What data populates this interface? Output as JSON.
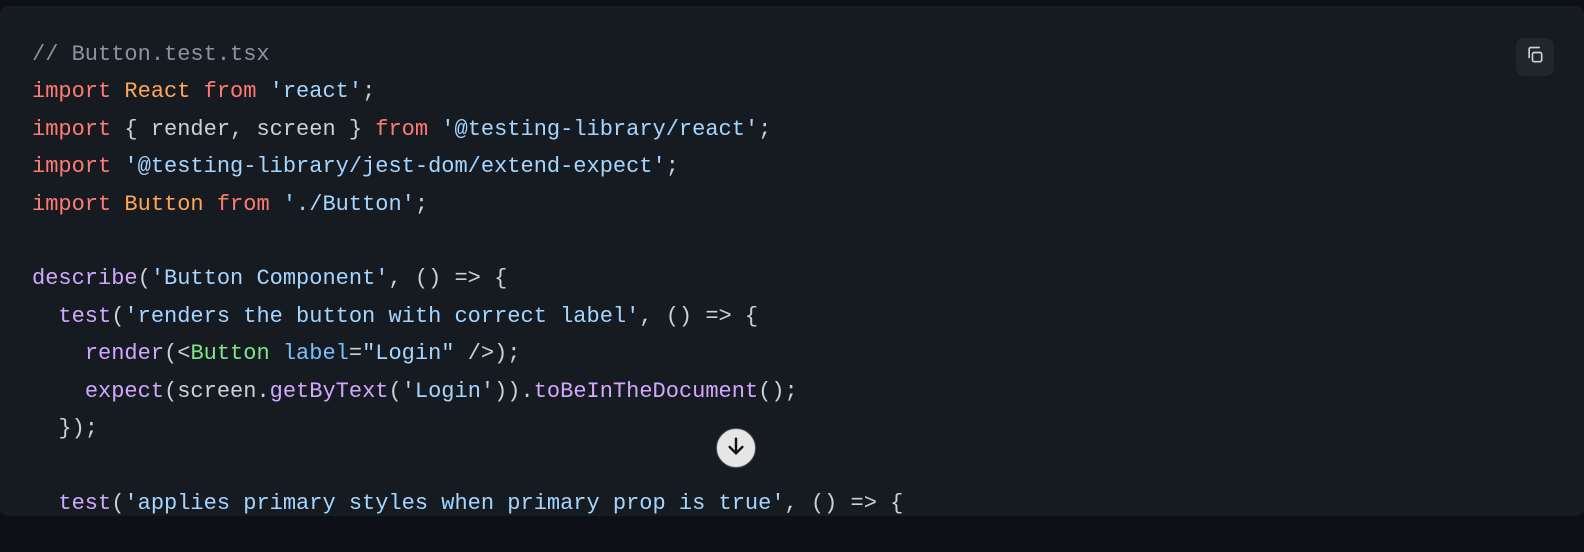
{
  "code": {
    "line1": {
      "comment": "// Button.test.tsx"
    },
    "line2": {
      "kw_import": "import",
      "name": "React",
      "kw_from": "from",
      "str": "'react'",
      "semi": ";"
    },
    "line3": {
      "kw_import": "import",
      "lbrace": " { ",
      "names": "render, screen",
      "rbrace": " } ",
      "kw_from": "from",
      "str": "'@testing-library/react'",
      "semi": ";"
    },
    "line4": {
      "kw_import": "import",
      "str": "'@testing-library/jest-dom/extend-expect'",
      "semi": ";"
    },
    "line5": {
      "kw_import": "import",
      "name": "Button",
      "kw_from": "from",
      "str": "'./Button'",
      "semi": ";"
    },
    "line7": {
      "func": "describe",
      "lparen": "(",
      "str": "'Button Component'",
      "rest": ", () => {"
    },
    "line8": {
      "indent": "  ",
      "func": "test",
      "lparen": "(",
      "str": "'renders the button with correct label'",
      "rest": ", () => {"
    },
    "line9": {
      "indent": "    ",
      "func": "render",
      "lparen": "(",
      "lt": "<",
      "comp": "Button",
      "sp": " ",
      "attr": "label",
      "eq": "=",
      "val": "\"Login\"",
      "close": " />",
      "rparen": ");"
    },
    "line10": {
      "indent": "    ",
      "func1": "expect",
      "p1": "(screen.",
      "func2": "getByText",
      "p2": "(",
      "str": "'Login'",
      "p3": ")).",
      "func3": "toBeInTheDocument",
      "p4": "();"
    },
    "line11": {
      "indent": "  ",
      "close": "});"
    },
    "line13": {
      "indent": "  ",
      "func": "test",
      "lparen": "(",
      "str": "'applies primary styles when primary prop is true'",
      "rest": ", () => {"
    }
  },
  "icons": {
    "copy": "copy",
    "arrow_down": "arrow-down"
  }
}
